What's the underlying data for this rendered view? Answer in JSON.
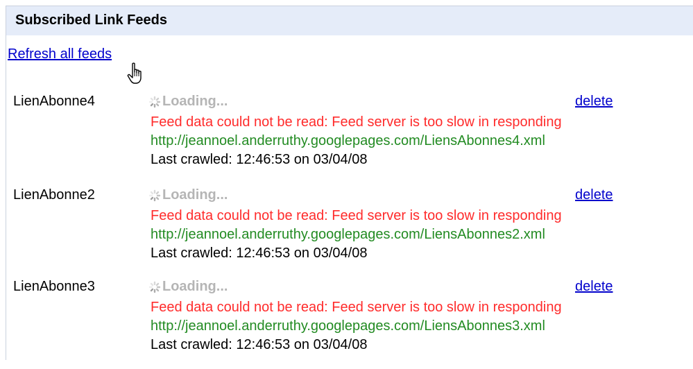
{
  "header": {
    "title": "Subscribed Link Feeds"
  },
  "refresh_label": "Refresh all feeds",
  "cursor": {
    "icon": "hand-pointer-cursor"
  },
  "colors": {
    "link": "#0000cc",
    "error": "#ff2b2b",
    "feed_url": "#228b22",
    "loading": "#b5b5b5",
    "header_bg": "#e5ecf9"
  },
  "feeds": [
    {
      "name": "LienAbonne4",
      "status": "Loading...",
      "delete_label": "delete",
      "error": "Feed data could not be read: Feed server is too slow in responding",
      "url": "http://jeannoel.anderruthy.googlepages.com/LiensAbonnes4.xml",
      "last_crawled": "Last crawled: 12:46:53 on 03/04/08"
    },
    {
      "name": "LienAbonne2",
      "status": "Loading...",
      "delete_label": "delete",
      "error": "Feed data could not be read: Feed server is too slow in responding",
      "url": "http://jeannoel.anderruthy.googlepages.com/LiensAbonnes2.xml",
      "last_crawled": "Last crawled: 12:46:53 on 03/04/08"
    },
    {
      "name": "LienAbonne3",
      "status": "Loading...",
      "delete_label": "delete",
      "error": "Feed data could not be read: Feed server is too slow in responding",
      "url": "http://jeannoel.anderruthy.googlepages.com/LiensAbonnes3.xml",
      "last_crawled": "Last crawled: 12:46:53 on 03/04/08"
    }
  ]
}
